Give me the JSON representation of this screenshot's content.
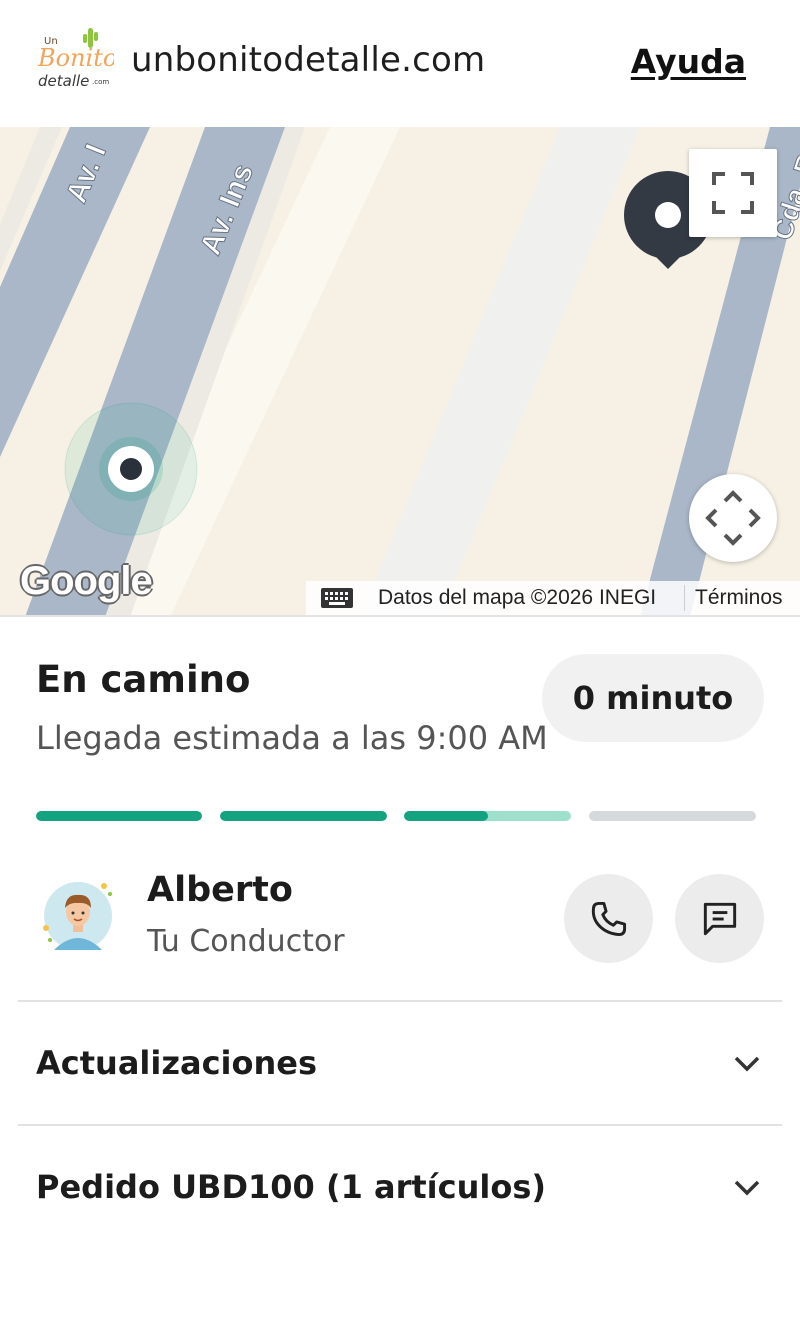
{
  "header": {
    "logo_text": "Un Bonito detalle.com",
    "site_name": "unbonitodetalle.com",
    "help_label": "Ayuda"
  },
  "map": {
    "street_labels": [
      "Av. I",
      "Av. Ins",
      "Cda. R"
    ],
    "provider": "Google",
    "attribution": "Datos del mapa ©2026 INEGI",
    "terms_label": "Términos",
    "icons": [
      "fullscreen-icon",
      "recenter-icon",
      "keyboard-icon",
      "destination-pin-icon",
      "driver-location-icon"
    ]
  },
  "status": {
    "title": "En camino",
    "eta": "Llegada estimada a las 9:00 AM",
    "minutes": "0 minuto",
    "progress_segments": [
      1,
      1,
      0.5,
      0
    ],
    "colors": {
      "accent": "#14a37f",
      "accent_light": "#9ee0cc",
      "inactive": "#d5d8dc"
    }
  },
  "driver": {
    "name": "Alberto",
    "role": "Tu Conductor",
    "call_icon": "phone-icon",
    "message_icon": "message-icon"
  },
  "sections": [
    {
      "label": "Actualizaciones"
    },
    {
      "label": "Pedido UBD100 (1 artículos)"
    }
  ]
}
